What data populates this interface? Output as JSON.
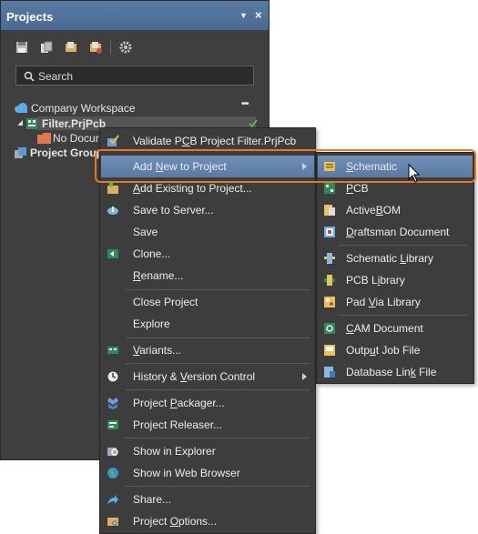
{
  "panel": {
    "title": "Projects",
    "dropdown_glyph": "▼",
    "close_glyph": "×",
    "toolbar_icons": [
      "save-icon",
      "copy-icon",
      "open-project-icon",
      "close-project-icon",
      "gear-icon"
    ],
    "search_placeholder": "Search",
    "tree": {
      "workspace": "Company Workspace",
      "workspace_more": "•••",
      "project": "Filter.PrjPcb",
      "folder": "No Docum",
      "group": "Project Group"
    }
  },
  "menu": {
    "items": [
      {
        "label": "Validate PCB Project Filter.PrjPcb",
        "icon": "validate-icon"
      },
      {
        "label": "Add New to Project",
        "icon": "none",
        "has_submenu": true,
        "highlighted": true
      },
      {
        "label": "Add Existing to Project...",
        "icon": "add-existing-icon"
      },
      {
        "label": "Save to Server...",
        "icon": "cloud-save-icon"
      },
      {
        "label": "Save",
        "icon": "none"
      },
      {
        "label": "Clone...",
        "icon": "clone-icon"
      },
      {
        "label": "Rename...",
        "icon": "none"
      },
      {
        "label": "Close Project",
        "icon": "none"
      },
      {
        "label": "Explore",
        "icon": "none"
      },
      {
        "label": "Variants...",
        "icon": "variants-icon"
      },
      {
        "label": "History & Version Control",
        "icon": "history-icon",
        "has_submenu": true
      },
      {
        "label": "Project Packager...",
        "icon": "packager-icon"
      },
      {
        "label": "Project Releaser...",
        "icon": "releaser-icon"
      },
      {
        "label": "Show in Explorer",
        "icon": "explorer-icon"
      },
      {
        "label": "Show in Web Browser",
        "icon": "globe-icon"
      },
      {
        "label": "Share...",
        "icon": "share-icon"
      },
      {
        "label": "Project Options...",
        "icon": "options-icon"
      }
    ]
  },
  "submenu": {
    "items": [
      {
        "label": "Schematic",
        "icon": "schematic-icon",
        "highlighted": true
      },
      {
        "label": "PCB",
        "icon": "pcb-icon"
      },
      {
        "label": "ActiveBOM",
        "icon": "activebom-icon"
      },
      {
        "label": "Draftsman Document",
        "icon": "draftsman-icon"
      },
      {
        "label": "Schematic Library",
        "icon": "schlib-icon"
      },
      {
        "label": "PCB Library",
        "icon": "pcblib-icon"
      },
      {
        "label": "Pad Via Library",
        "icon": "padvia-icon"
      },
      {
        "label": "CAM Document",
        "icon": "cam-icon"
      },
      {
        "label": "Output Job File",
        "icon": "outjob-icon"
      },
      {
        "label": "Database Link File",
        "icon": "dblink-icon"
      }
    ]
  },
  "colors": {
    "panel_bg": "#3f3f3f",
    "title_bar": "#587aa3",
    "highlight": "#6f8fb8",
    "callout": "#e8781e"
  }
}
